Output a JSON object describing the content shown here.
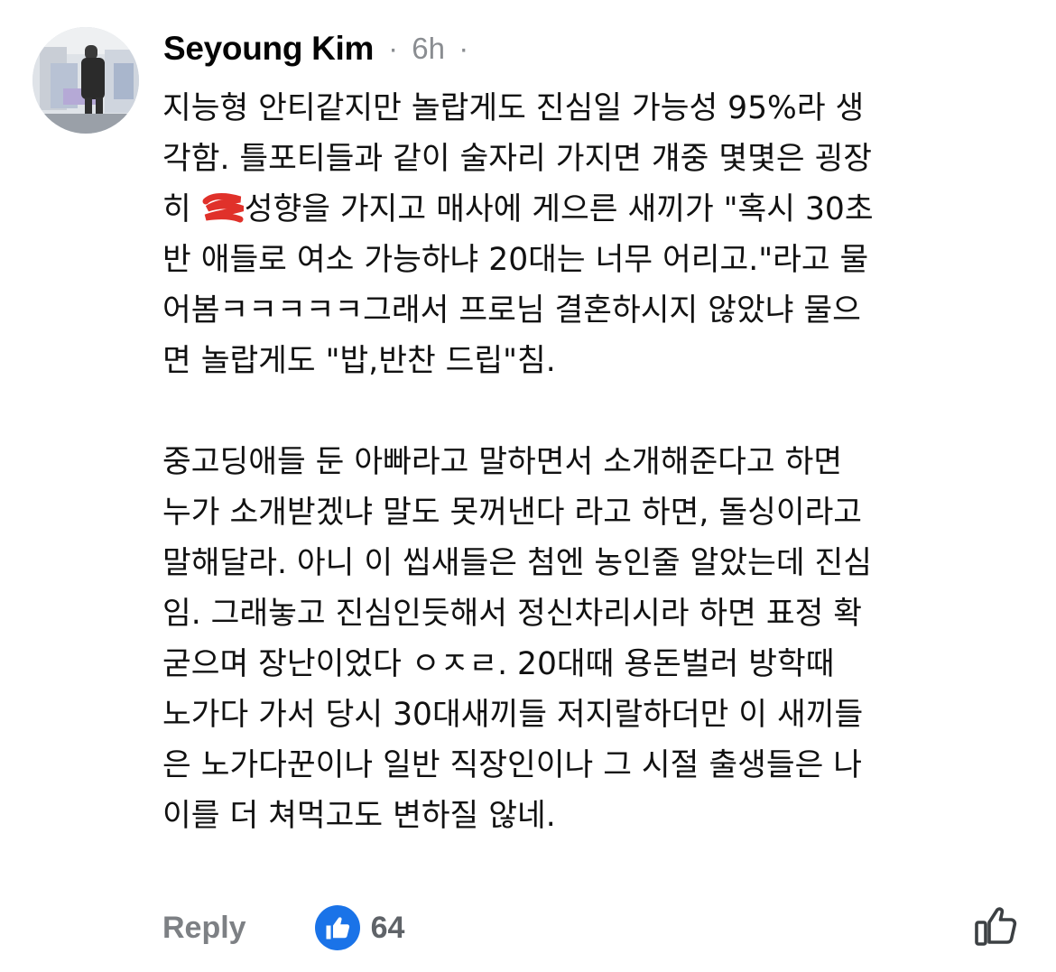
{
  "comment": {
    "author": "Seyoung Kim",
    "dot": "·",
    "time": "6h",
    "paragraph1": [
      "지능형 안티같지만 놀랍게도 진심일 가능성 95%라 생",
      "각함. 틀포티들과 같이 술자리 가지면 걔중 몇몇은 굉장",
      "히 ",
      "성향을 가지고 매사에 게으른 새끼가 \"혹시 30초",
      "반 애들로 여소 가능하냐 20대는 너무 어리고.\"라고 물",
      "어봄ㅋㅋㅋㅋㅋ그래서 프로님 결혼하시지 않았냐 물으",
      "면 놀랍게도 \"밥,반찬 드립\"침."
    ],
    "paragraph2": [
      "중고딩애들 둔 아빠라고 말하면서 소개해준다고 하면",
      "누가 소개받겠냐 말도 못꺼낸다 라고 하면, 돌싱이라고",
      "말해달라. 아니 이 씹새들은 첨엔 농인줄 알았는데 진심",
      "임. 그래놓고 진심인듯해서 정신차리시라 하면 표정 확",
      "굳으며 장난이었다 ㅇㅈㄹ. 20대때 용돈벌러 방학때",
      "노가다 가서 당시 30대새끼들 저지랄하더만 이 새끼들",
      "은 노가다꾼이나 일반 직장인이나 그 시절 출생들은 나",
      "이를 더 쳐먹고도 변하질 않네."
    ],
    "actions": {
      "reply_label": "Reply",
      "like_count": "64"
    }
  },
  "colors": {
    "author": "#050505",
    "meta": "#8a8d91",
    "reply": "#7d8084",
    "like_badge": "#1a73e8",
    "count": "#5f6368"
  },
  "icons": {
    "avatar": "profile-photo",
    "redaction": "red-scribble",
    "reaction": "thumbs-up-icon",
    "like_button": "thumbs-up-outline-icon"
  }
}
